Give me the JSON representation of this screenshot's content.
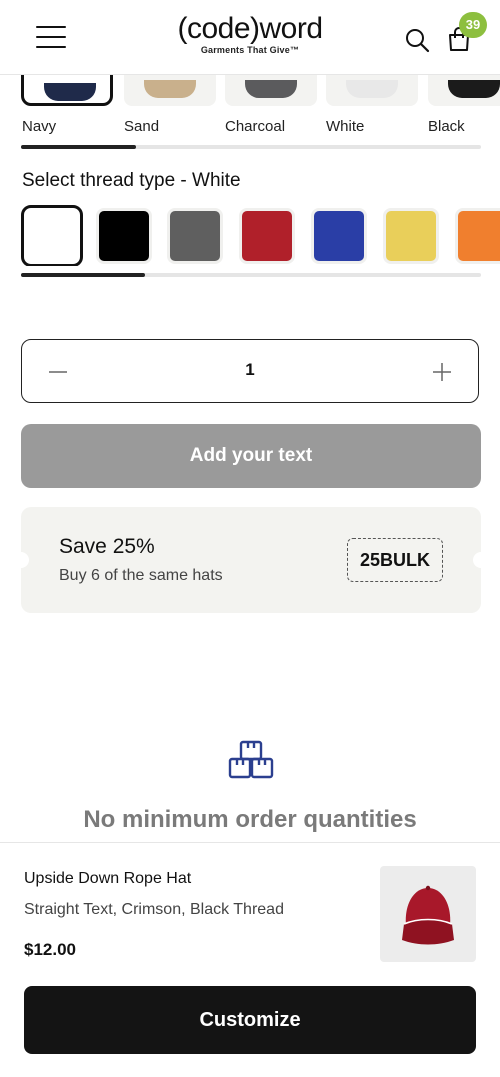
{
  "header": {
    "brand_name": "(code)word",
    "brand_tagline": "Garments That Give™",
    "cart_count": "39",
    "badge_color": "#8dbf3f"
  },
  "hat_colors": {
    "items": [
      {
        "label": "Navy",
        "color": "#1f2a4a",
        "selected": true
      },
      {
        "label": "Sand",
        "color": "#c9b08c",
        "selected": false
      },
      {
        "label": "Charcoal",
        "color": "#5b5b5d",
        "selected": false
      },
      {
        "label": "White",
        "color": "#e8e8e8",
        "selected": false
      },
      {
        "label": "Black",
        "color": "#1b1b1b",
        "selected": false
      }
    ],
    "scroll_progress": 0.25
  },
  "thread": {
    "title": "Select thread type - White",
    "swatches": [
      {
        "name": "white",
        "color": "#ffffff",
        "selected": true
      },
      {
        "name": "black",
        "color": "#000000",
        "selected": false
      },
      {
        "name": "grey",
        "color": "#5f5f5f",
        "selected": false
      },
      {
        "name": "red",
        "color": "#b0202a",
        "selected": false
      },
      {
        "name": "blue",
        "color": "#2a3ea6",
        "selected": false
      },
      {
        "name": "yellow",
        "color": "#e9cf5a",
        "selected": false
      },
      {
        "name": "orange",
        "color": "#f07f2e",
        "selected": false
      }
    ],
    "scroll_progress": 0.27
  },
  "quantity": {
    "value": "1",
    "minus_icon": "minus-icon",
    "plus_icon": "plus-icon"
  },
  "add_text": {
    "label": "Add your text"
  },
  "coupon": {
    "title": "Save 25%",
    "subtitle": "Buy 6 of the same hats",
    "code": "25BULK"
  },
  "info": {
    "icon": "boxes-icon",
    "text": "No minimum order quantities",
    "icon_color": "#2b3f8f"
  },
  "product": {
    "name": "Upside Down Rope Hat",
    "variant": "Straight Text, Crimson, Black Thread",
    "price": "$12.00",
    "thumb_hat_color": "#a8182a"
  },
  "cta": {
    "label": "Customize"
  }
}
